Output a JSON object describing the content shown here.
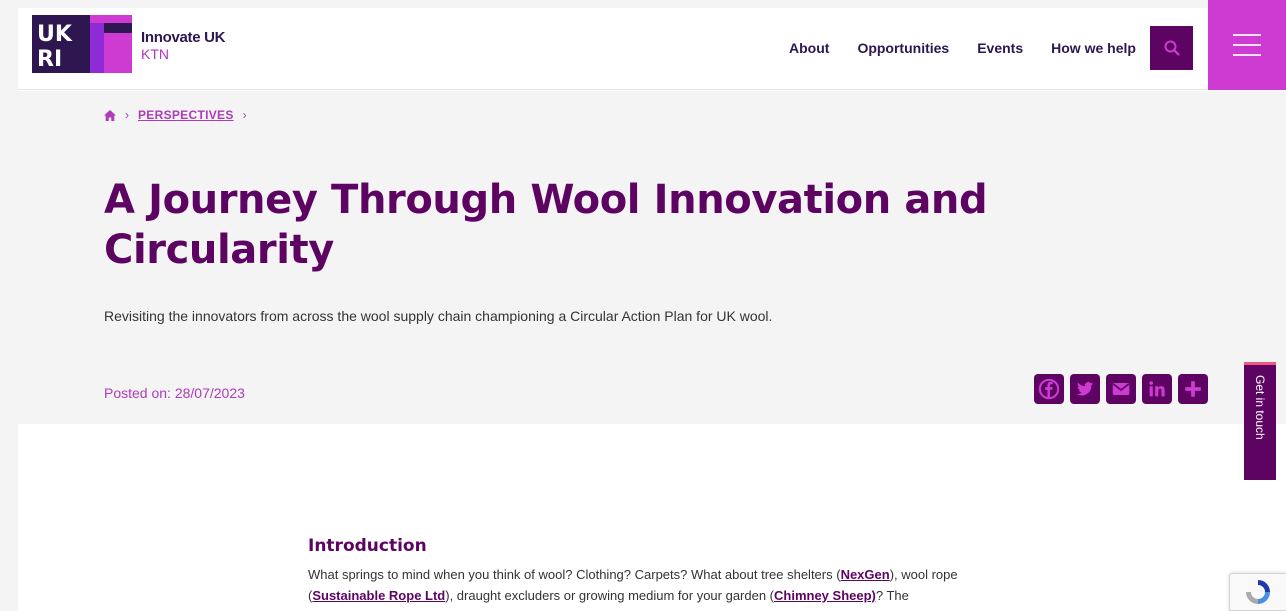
{
  "header": {
    "brand_line1": "Innovate UK",
    "brand_line2": "KTN",
    "nav": [
      {
        "label": "About"
      },
      {
        "label": "Opportunities"
      },
      {
        "label": "Events"
      },
      {
        "label": "How we help"
      }
    ],
    "search_icon": "search-icon",
    "menu_icon": "hamburger-icon",
    "logo_text": "UKRI"
  },
  "breadcrumb": {
    "home_icon": "home-icon",
    "section": "PERSPECTIVES"
  },
  "article": {
    "title": "A Journey Through Wool Innovation and Circularity",
    "summary": "Revisiting the innovators from across the wool supply chain championing a Circular Action Plan for UK wool.",
    "posted": "Posted on: 28/07/2023"
  },
  "share": [
    "facebook-icon",
    "twitter-icon",
    "email-icon",
    "linkedin-icon",
    "plus-icon"
  ],
  "get_in_touch": "Get in touch",
  "content": {
    "heading": "Introduction",
    "p1": "What springs to mind when you think of wool? Clothing? Carpets? What about tree shelters (",
    "link1": "NexGen",
    "p2": "), wool rope (",
    "link2": "Sustainable Rope Ltd",
    "p3": "), draught excluders or growing medium for your garden (",
    "link3": "Chimney Sheep)",
    "p4": "? The"
  },
  "colors": {
    "primary": "#5d0463",
    "accent": "#ce3bd3",
    "link_pink": "#ae3bb8",
    "brand_navy": "#2e1651"
  }
}
